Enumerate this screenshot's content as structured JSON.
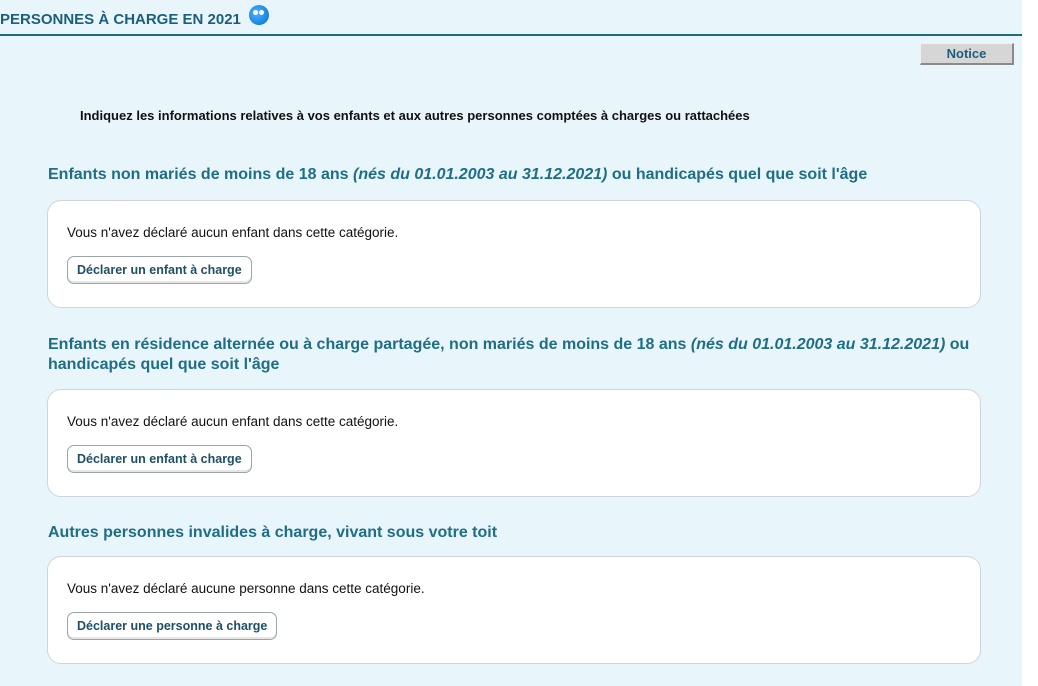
{
  "header": {
    "title": "PERSONNES À CHARGE EN 2021"
  },
  "notice_button": "Notice",
  "intro": "Indiquez les informations relatives à vos enfants et aux autres personnes comptées à charges ou rattachées",
  "sections": [
    {
      "title_prefix": "Enfants non mariés de moins de 18 ans ",
      "title_italic": "(nés du 01.01.2003 au 31.12.2021)",
      "title_suffix": " ou handicapés quel que soit l'âge",
      "message": "Vous n'avez déclaré aucun enfant dans cette catégorie.",
      "button": "Déclarer un enfant à charge"
    },
    {
      "title_prefix": "Enfants en résidence alternée ou à charge partagée, non mariés de moins de 18 ans ",
      "title_italic": "(nés du 01.01.2003 au 31.12.2021)",
      "title_suffix": " ou handicapés quel que soit l'âge",
      "message": "Vous n'avez déclaré aucun enfant dans cette catégorie.",
      "button": "Déclarer un enfant à charge"
    },
    {
      "title_prefix": "Autres personnes invalides à charge, vivant sous votre toit",
      "title_italic": "",
      "title_suffix": "",
      "message": "Vous n'avez déclaré aucune personne dans cette catégorie.",
      "button": "Déclarer une personne à charge"
    }
  ]
}
